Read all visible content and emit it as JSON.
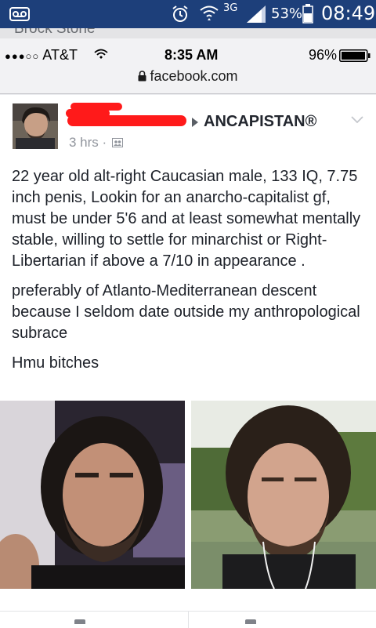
{
  "android_status": {
    "network": "3G",
    "battery": "53%",
    "time": "08:49",
    "icons": [
      "voicemail-icon",
      "alarm-icon",
      "wifi-icon",
      "signal-icon",
      "battery-icon"
    ]
  },
  "peek": {
    "text": "Brock Stone"
  },
  "ios_status": {
    "signal_dots": "●●●○○",
    "carrier": "AT&T",
    "time": "8:35 AM",
    "battery": "96%"
  },
  "url_bar": {
    "domain": "facebook.com"
  },
  "post": {
    "group": "ANCAPISTAN®",
    "time": "3 hrs",
    "separator": "·",
    "paragraphs": [
      "22 year old alt-right Caucasian male, 133 IQ, 7.75 inch penis, Lookin for an anarcho-capitalist gf, must be under 5'6 and at least somewhat mentally stable, willing to settle for minarchist or Right-Libertarian if above a 7/10 in appearance .",
      "preferably of Atlanto-Mediterranean descent because I seldom date outside my anthropological subrace",
      "Hmu bitches"
    ]
  },
  "colors": {
    "android_bar": "#1d3f7a",
    "redaction": "#ff1a1a",
    "text": "#1d2129",
    "meta": "#90949c"
  }
}
